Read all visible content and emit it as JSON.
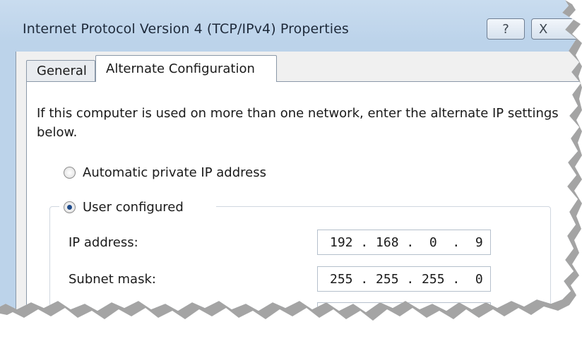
{
  "window": {
    "title": "Internet Protocol Version 4 (TCP/IPv4) Properties",
    "help_label": "?",
    "close_label": "X"
  },
  "tabs": [
    {
      "label": "General",
      "selected": false
    },
    {
      "label": "Alternate Configuration",
      "selected": true
    }
  ],
  "panel": {
    "description": "If this computer is used on more than one network, enter the alternate IP settings below.",
    "options": [
      {
        "label": "Automatic private IP address",
        "checked": false
      },
      {
        "label": "User configured",
        "checked": true
      }
    ],
    "fields": [
      {
        "label": "IP address:",
        "value": "192 . 168 .  0  .  9"
      },
      {
        "label": "Subnet mask:",
        "value": "255 . 255 . 255 .  0"
      }
    ]
  },
  "colors": {
    "title_bar": "#bcd3ea",
    "panel_bg": "#ffffff",
    "radio_dot": "#1e4a8a"
  }
}
